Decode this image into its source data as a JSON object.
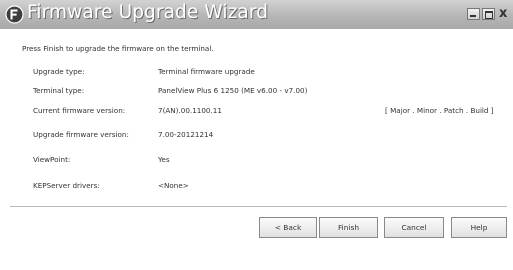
{
  "window": {
    "title": "Firmware Upgrade Wizard",
    "close_glyph": "x",
    "colors": {
      "titlebar": "#b6b6b6",
      "title_text": "#ffffff",
      "background": "#ffffff"
    }
  },
  "intro_text": "Press Finish to upgrade the firmware on the terminal.",
  "details": [
    {
      "label": "Upgrade type:",
      "value": "Terminal firmware upgrade"
    },
    {
      "label": "Terminal type:",
      "value": "PanelView Plus 6   1250  (ME v6.00 - v7.00)"
    },
    {
      "label": "Current firmware version:",
      "value": "7(AN).00.1100.11",
      "hint": "[ Major . Minor . Patch . Build ]"
    },
    {
      "label": "Upgrade firmware version:",
      "value": "7.00-20121214"
    },
    {
      "label": "ViewPoint:",
      "value": "Yes"
    },
    {
      "label": "KEPServer drivers:",
      "value": "<None>"
    }
  ],
  "buttons": {
    "back": "< Back",
    "finish": "Finish",
    "cancel": "Cancel",
    "help": "Help"
  },
  "icons": {
    "title": "wizard-icon",
    "minimize": "minimize-icon",
    "maximize": "maximize-icon",
    "close": "close-icon"
  }
}
